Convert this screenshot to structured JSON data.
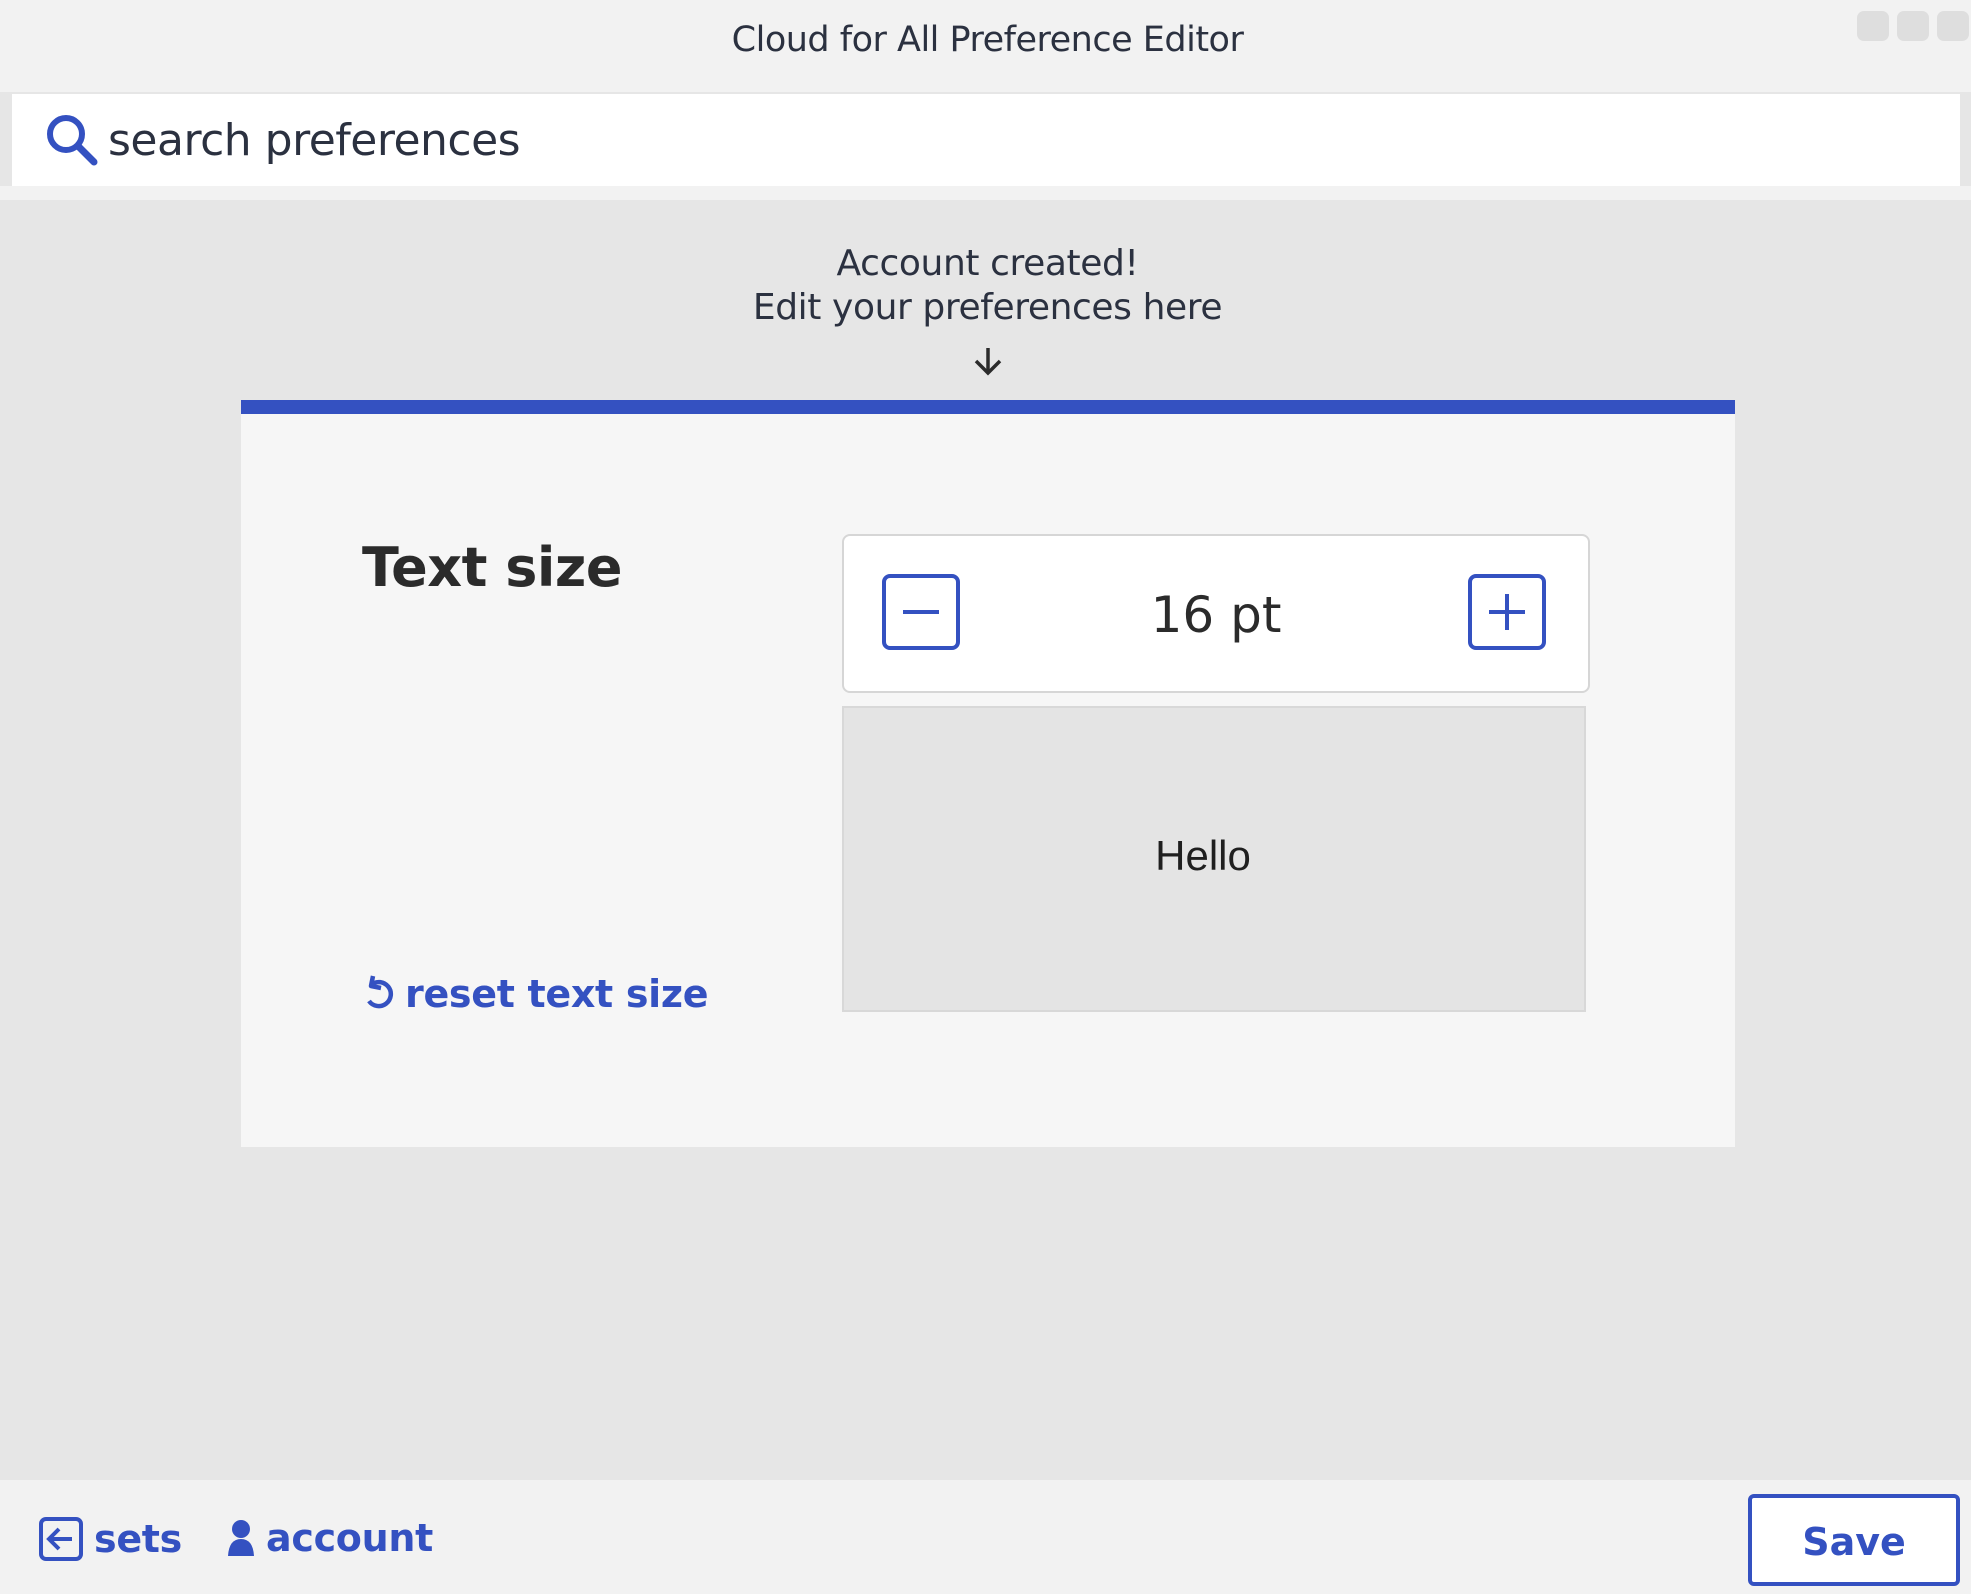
{
  "window": {
    "title": "Cloud for All Preference Editor"
  },
  "search": {
    "placeholder": "search preferences",
    "icon": "search-icon"
  },
  "notice": {
    "line1": "Account created!",
    "line2": "Edit your preferences here",
    "icon": "arrow-down-icon"
  },
  "preference": {
    "title": "Text size",
    "value": "16 pt",
    "decrease_icon": "minus-icon",
    "increase_icon": "plus-icon",
    "preview_text": "Hello",
    "reset_label": "reset text size",
    "reset_icon": "undo-icon"
  },
  "footer": {
    "sets_label": "sets",
    "sets_icon": "exit-arrow-icon",
    "account_label": "account",
    "account_icon": "person-icon",
    "save_label": "Save"
  },
  "colors": {
    "accent": "#3451c1",
    "background": "#e6e6e6",
    "card": "#f6f6f6",
    "text": "#2b3140"
  }
}
